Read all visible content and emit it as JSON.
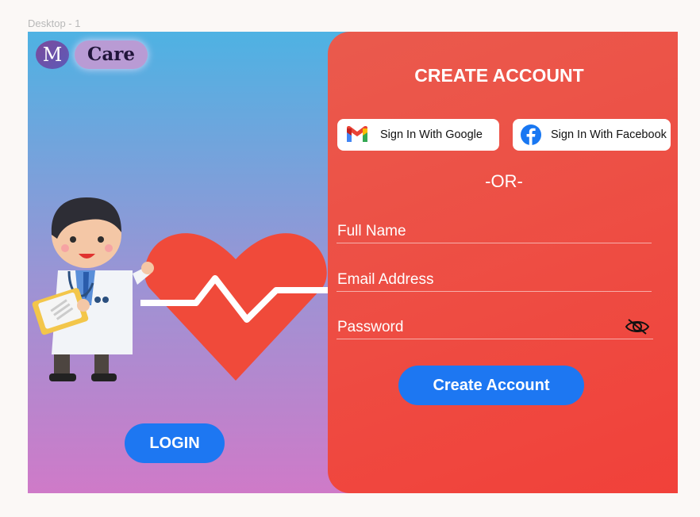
{
  "frame": {
    "label": "Desktop - 1"
  },
  "logo": {
    "letter": "M",
    "name": "Care"
  },
  "left": {
    "login_label": "LOGIN"
  },
  "right": {
    "title": "CREATE ACCOUNT",
    "google_label": "Sign In With Google",
    "facebook_label": "Sign In With Facebook",
    "or_text": "-OR-",
    "fields": {
      "full_name": "Full Name",
      "email": "Email Address",
      "password": "Password"
    },
    "submit_label": "Create Account"
  },
  "colors": {
    "primary_button": "#1d77f2",
    "panel": "#ef4b40",
    "gradient_top": "#4eb2e3",
    "gradient_bottom": "#cf7ac8"
  },
  "icons": [
    "gmail-icon",
    "facebook-icon",
    "eye-slash-icon",
    "doctor-illustration",
    "heart-pulse-illustration"
  ]
}
